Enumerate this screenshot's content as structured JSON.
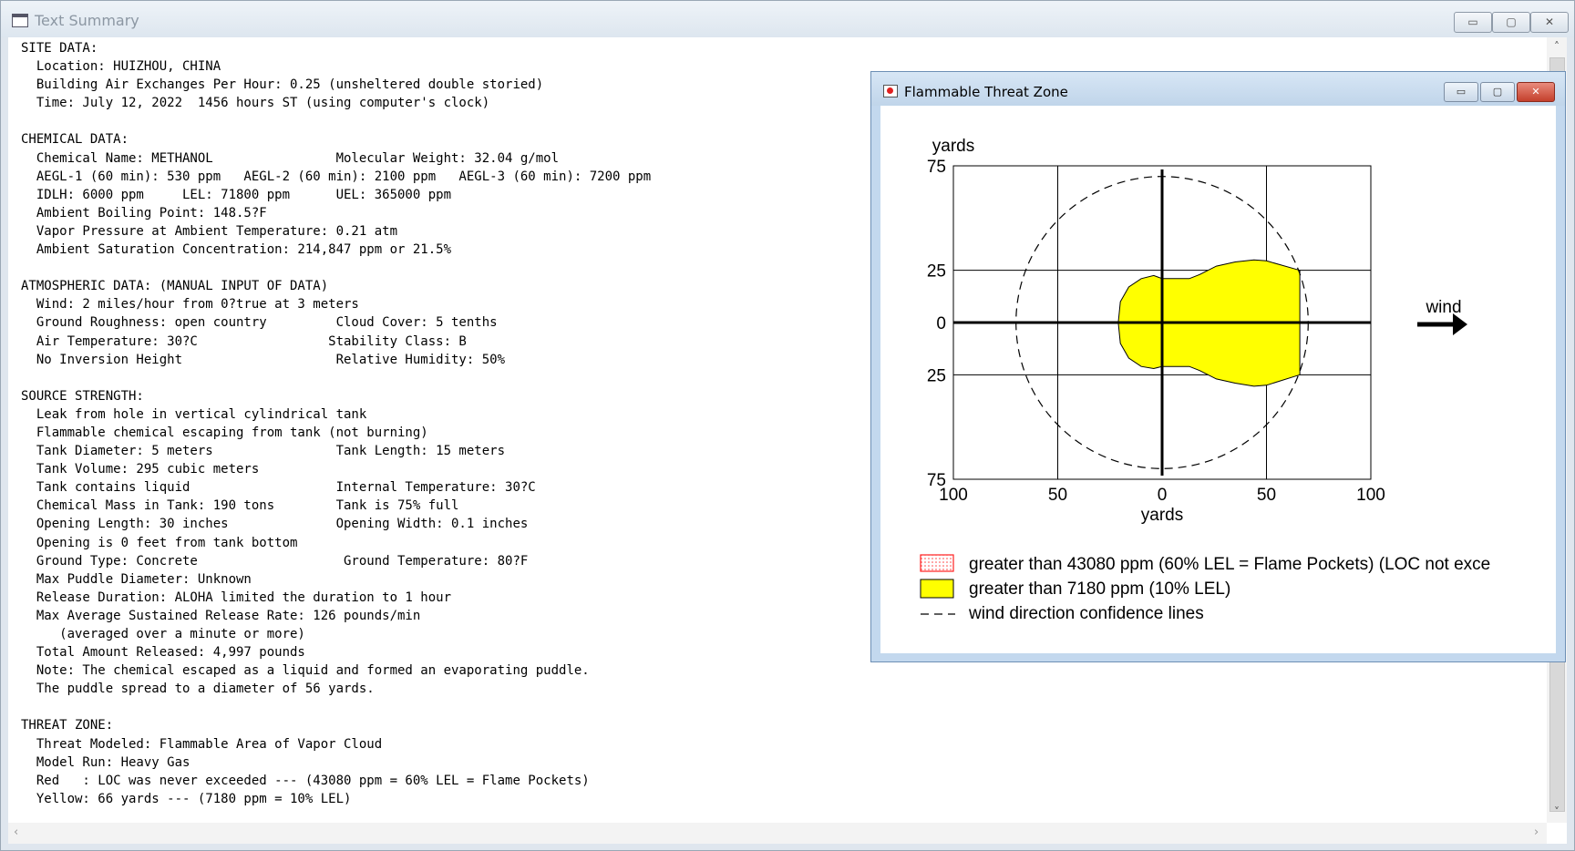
{
  "main_window": {
    "title": "Text Summary",
    "min_symbol": "▭",
    "max_symbol": "▢",
    "close_symbol": "✕"
  },
  "summary": {
    "lines": [
      "SITE DATA:",
      "  Location: HUIZHOU, CHINA",
      "  Building Air Exchanges Per Hour: 0.25 (unsheltered double storied)",
      "  Time: July 12, 2022  1456 hours ST (using computer's clock)",
      "",
      "CHEMICAL DATA:",
      "  Chemical Name: METHANOL                Molecular Weight: 32.04 g/mol",
      "  AEGL-1 (60 min): 530 ppm   AEGL-2 (60 min): 2100 ppm   AEGL-3 (60 min): 7200 ppm",
      "  IDLH: 6000 ppm     LEL: 71800 ppm      UEL: 365000 ppm",
      "  Ambient Boiling Point: 148.5?F",
      "  Vapor Pressure at Ambient Temperature: 0.21 atm",
      "  Ambient Saturation Concentration: 214,847 ppm or 21.5%",
      "",
      "ATMOSPHERIC DATA: (MANUAL INPUT OF DATA)",
      "  Wind: 2 miles/hour from 0?true at 3 meters",
      "  Ground Roughness: open country         Cloud Cover: 5 tenths",
      "  Air Temperature: 30?C                 Stability Class: B",
      "  No Inversion Height                    Relative Humidity: 50%",
      "",
      "SOURCE STRENGTH:",
      "  Leak from hole in vertical cylindrical tank",
      "  Flammable chemical escaping from tank (not burning)",
      "  Tank Diameter: 5 meters                Tank Length: 15 meters",
      "  Tank Volume: 295 cubic meters",
      "  Tank contains liquid                   Internal Temperature: 30?C",
      "  Chemical Mass in Tank: 190 tons        Tank is 75% full",
      "  Opening Length: 30 inches              Opening Width: 0.1 inches",
      "  Opening is 0 feet from tank bottom",
      "  Ground Type: Concrete                   Ground Temperature: 80?F",
      "  Max Puddle Diameter: Unknown",
      "  Release Duration: ALOHA limited the duration to 1 hour",
      "  Max Average Sustained Release Rate: 126 pounds/min",
      "     (averaged over a minute or more)",
      "  Total Amount Released: 4,997 pounds",
      "  Note: The chemical escaped as a liquid and formed an evaporating puddle.",
      "  The puddle spread to a diameter of 56 yards.",
      "",
      "THREAT ZONE:",
      "  Threat Modeled: Flammable Area of Vapor Cloud",
      "  Model Run: Heavy Gas",
      "  Red   : LOC was never exceeded --- (43080 ppm = 60% LEL = Flame Pockets)",
      "  Yellow: 66 yards --- (7180 ppm = 10% LEL)"
    ]
  },
  "threat_window": {
    "title": "Flammable Threat Zone",
    "min_symbol": "▭",
    "max_symbol": "▢",
    "close_symbol": "✕",
    "y_unit": "yards",
    "x_unit": "yards",
    "wind_label": "wind",
    "legend": [
      {
        "label": "greater than 43080 ppm (60% LEL = Flame Pockets) (LOC not exce",
        "swatch": "red-dotted"
      },
      {
        "label": "greater than 7180 ppm (10% LEL)",
        "swatch": "yellow"
      },
      {
        "label": "wind direction confidence lines",
        "swatch": "dashed-line"
      }
    ]
  },
  "chart_data": {
    "type": "area",
    "xlabel": "yards",
    "ylabel": "yards",
    "xlim": [
      -100,
      100
    ],
    "ylim": [
      -75,
      75
    ],
    "x_tick_labels": [
      "100",
      "50",
      "0",
      "50",
      "100"
    ],
    "x_ticks": [
      -100,
      -50,
      0,
      50,
      100
    ],
    "y_tick_labels": [
      "75",
      "25",
      "0",
      "25",
      "75"
    ],
    "y_ticks": [
      75,
      25,
      0,
      -25,
      -75
    ],
    "grid": true,
    "confidence_circle_radius_yards": 70,
    "yellow_zone_color": "#ffff00",
    "red_zone_color": "#ff0000",
    "yellow_zone_outline": [
      [
        -21,
        0
      ],
      [
        -20,
        10
      ],
      [
        -16,
        17
      ],
      [
        -10,
        21
      ],
      [
        -4,
        22.5
      ],
      [
        0,
        21
      ],
      [
        13,
        21
      ],
      [
        18,
        23
      ],
      [
        26,
        27
      ],
      [
        35,
        29
      ],
      [
        44,
        30
      ],
      [
        50,
        29.5
      ],
      [
        66,
        25
      ],
      [
        66,
        -25
      ],
      [
        50,
        -30
      ],
      [
        44,
        -30.5
      ],
      [
        35,
        -29
      ],
      [
        26,
        -27
      ],
      [
        18,
        -23
      ],
      [
        13,
        -21
      ],
      [
        0,
        -21
      ],
      [
        -4,
        -22
      ],
      [
        -10,
        -21
      ],
      [
        -16,
        -17
      ],
      [
        -20,
        -10
      ]
    ]
  }
}
